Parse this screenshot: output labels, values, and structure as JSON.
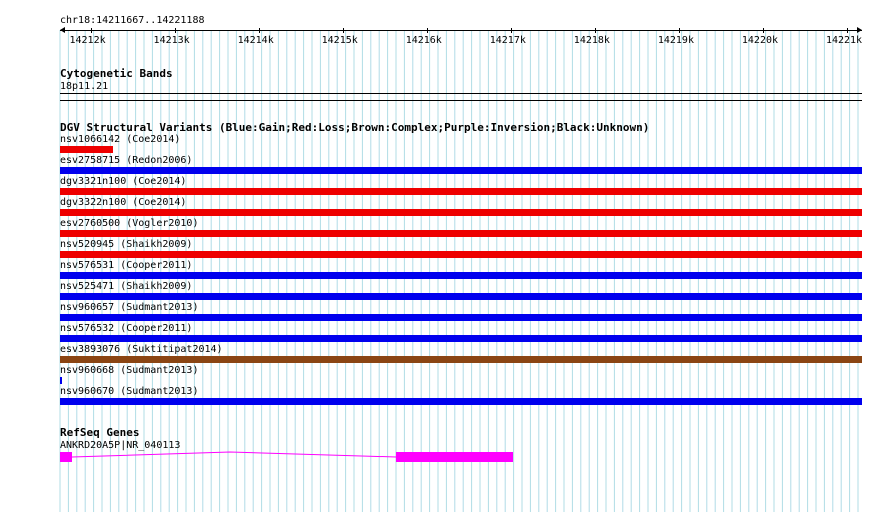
{
  "ruler": {
    "location": "chr18:14211667..14221188",
    "ticks": [
      "14212k",
      "14213k",
      "14214k",
      "14215k",
      "14216k",
      "14217k",
      "14218k",
      "14219k",
      "14220k",
      "14221k"
    ]
  },
  "cytoband": {
    "title": "Cytogenetic Bands",
    "band": "18p11.21"
  },
  "dgv": {
    "title": "DGV Structural Variants (Blue:Gain;Red:Loss;Brown:Complex;Purple:Inversion;Black:Unknown)",
    "colors": {
      "gain": "#0000ee",
      "loss": "#ee0000",
      "complex": "#8b4513",
      "inversion": "#800080",
      "unknown": "#000000"
    },
    "variants": [
      {
        "label": "nsv1066142 (Coe2014)",
        "type": "loss",
        "start": 0.0,
        "end": 0.066
      },
      {
        "label": "esv2758715 (Redon2006)",
        "type": "gain",
        "start": 0.0,
        "end": 1.0
      },
      {
        "label": "dgv3321n100 (Coe2014)",
        "type": "loss",
        "start": 0.0,
        "end": 1.0
      },
      {
        "label": "dgv3322n100 (Coe2014)",
        "type": "loss",
        "start": 0.0,
        "end": 1.0
      },
      {
        "label": "esv2760500 (Vogler2010)",
        "type": "loss",
        "start": 0.0,
        "end": 1.0
      },
      {
        "label": "nsv520945 (Shaikh2009)",
        "type": "loss",
        "start": 0.0,
        "end": 1.0
      },
      {
        "label": "nsv576531 (Cooper2011)",
        "type": "gain",
        "start": 0.0,
        "end": 1.0
      },
      {
        "label": "nsv525471 (Shaikh2009)",
        "type": "gain",
        "start": 0.0,
        "end": 1.0
      },
      {
        "label": "nsv960657 (Sudmant2013)",
        "type": "gain",
        "start": 0.0,
        "end": 1.0
      },
      {
        "label": "nsv576532 (Cooper2011)",
        "type": "gain",
        "start": 0.0,
        "end": 1.0
      },
      {
        "label": "esv3893076 (Suktitipat2014)",
        "type": "complex",
        "start": 0.0,
        "end": 1.0
      },
      {
        "label": "nsv960668 (Sudmant2013)",
        "type": "gain",
        "start": 0.0,
        "end": 0.003
      },
      {
        "label": "nsv960670 (Sudmant2013)",
        "type": "gain",
        "start": 0.0,
        "end": 1.0
      }
    ]
  },
  "refseq": {
    "title": "RefSeq Genes",
    "gene": "ANKRD20A5P|NR_040113",
    "color": "#ff00ff"
  }
}
